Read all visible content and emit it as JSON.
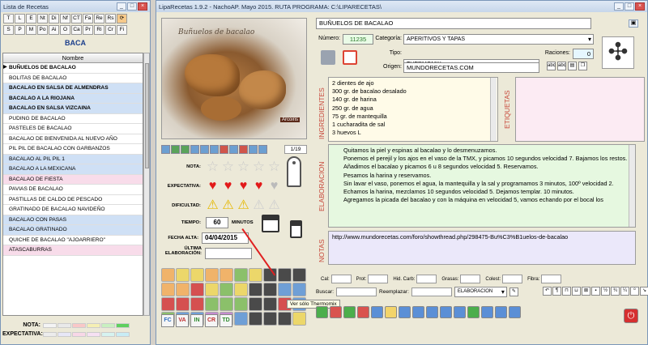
{
  "left_window": {
    "title": "Lista de Recetas",
    "letters_row1": [
      "T",
      "L",
      "E",
      "Nt",
      "Di",
      "Nf",
      "CT",
      "Fa",
      "Re",
      "Rs"
    ],
    "letters_row2": [
      "S",
      "P",
      "M",
      "Po",
      "Ai",
      "O",
      "Ca",
      "Pr",
      "Ri",
      "Cr",
      "Fi"
    ],
    "section": "BACA",
    "column_header": "Nombre",
    "recipes": [
      {
        "name": "BUÑUELOS DE BACALAO",
        "style": "white",
        "bold": true,
        "current": true
      },
      {
        "name": "BOLITAS DE BACALAO",
        "style": "white"
      },
      {
        "name": "BACALAO EN SALSA DE ALMENDRAS",
        "style": "blue",
        "bold": true
      },
      {
        "name": "BACALAO A LA RIOJANA",
        "style": "blue",
        "bold": true
      },
      {
        "name": "BACALAO EN SALSA VIZCAINA",
        "style": "blue",
        "bold": true
      },
      {
        "name": "PUDING DE BACALAO",
        "style": "white"
      },
      {
        "name": "PASTELES DE BACALAO",
        "style": "white"
      },
      {
        "name": "BACALAO DE BIENVENIDA AL NUEVO AÑO",
        "style": "white"
      },
      {
        "name": "PIL PIL DE BACALAO CON GARBANZOS",
        "style": "white"
      },
      {
        "name": "BACALAO AL PIL PIL 1",
        "style": "blue"
      },
      {
        "name": "BACALAO A LA MEXICANA",
        "style": "blue"
      },
      {
        "name": "BACALAO DE FIESTA",
        "style": "pink"
      },
      {
        "name": "PAVIAS DE BACALAO",
        "style": "white"
      },
      {
        "name": "PASTILLAS DE CALDO DE PESCADO",
        "style": "white"
      },
      {
        "name": "GRATINADO DE BACALAO NAVIDEÑO",
        "style": "white"
      },
      {
        "name": "BACALAO CON PASAS",
        "style": "blue"
      },
      {
        "name": "BACALAO GRATINADO",
        "style": "blue"
      },
      {
        "name": "QUICHE DE BACALAO \"AJOARRIERO\"",
        "style": "white"
      },
      {
        "name": "ATASCABURRAS",
        "style": "pink"
      }
    ],
    "legend": {
      "nota_label": "NOTA:",
      "expectativa_label": "EXPECTATIVA:"
    }
  },
  "main_window": {
    "title": "LipaRecetas 1.9.2 - NachoAP. Mayo 2015. RUTA PROGRAMA: C:\\LIPARECETAS\\",
    "photo_caption": "Buñuelos de bacalao",
    "photo_signature": "Arcoiris",
    "counter": "1/19",
    "labels": {
      "nota": "NOTA:",
      "expectativa": "EXPECTATIVA:",
      "dificultad": "DIFICULTAD:",
      "tiempo": "TIEMPO:",
      "minutos": "MINUTOS",
      "fecha_alta": "FECHA ALTA:",
      "ultima_elab_1": "ÚLTIMA",
      "ultima_elab_2": "ELABORACIÓN:"
    },
    "nota_stars": 0,
    "expectativa_hearts": 4,
    "dificultad_level": 3,
    "tiempo": "60",
    "fecha_alta": "04/04/2015",
    "ultima_elaboracion": "",
    "codes": [
      "FC",
      "VA",
      "IN",
      "CR",
      "TD"
    ],
    "tooltip": "Ver sólo Thermomix",
    "recipe_title": "BUÑUELOS DE BACALAO",
    "numero_label": "Número:",
    "numero": "11235",
    "categoria_label": "Categoría:",
    "categoria": "APERITIVOS Y TAPAS",
    "tipo_label": "Tipo:",
    "tipo": "THERMOMIX",
    "raciones_label": "Raciones:",
    "raciones": "0",
    "origen_label": "Origen:",
    "origen": "MUNDORECETAS.COM",
    "ingredientes_label": "INGREDIENTES",
    "etiquetas_label": "ETIQUETAS",
    "elaboracion_label": "ELABORACION",
    "notas_label": "NOTAS",
    "ingredientes": [
      "2 dientes de ajo",
      "300 gr. de bacalao desalado",
      "140 gr. de harina",
      "250 gr. de agua",
      "75 gr. de mantequilla",
      "1 cucharadita de sal",
      "3 huevos L"
    ],
    "elaboracion": [
      "Quitamos la piel y espinas al bacalao y lo desmenuzamos.",
      "Ponemos el perejil y los ajos en el vaso de la TMX, y picamos 10 segundos velocidad 7. Bajamos los restos.",
      "Añadimos el bacalao y picamos 6 u 8 segundos velocidad 5. Reservamos.",
      "Pesamos la harina y reservamos.",
      "Sin lavar el vaso, ponemos el agua, la mantequilla y la sal y programamos 3 minutos, 100º velocidad 2.",
      "Echamos la harina, mezclamos 10 segundos velocidad 5. Dejamos templar. 10 minutos.",
      "Agregamos la picada del bacalao y con la máquina en velocidad 5, vamos echando por el bocal los"
    ],
    "notas": "http://www.mundorecetas.com/foro/showthread.php/298475-Bu%C3%B1uelos-de-bacalao",
    "nutrition": {
      "cal": "Cal:",
      "prot": "Prot:",
      "hid": "Hid. Carb:",
      "grasas": "Grasas:",
      "colest": "Colest:",
      "fibra": "Fibra:"
    },
    "buscar_label": "Buscar:",
    "reemplazar_label": "Reemplazar:",
    "search_scope": "ELABORACION"
  }
}
